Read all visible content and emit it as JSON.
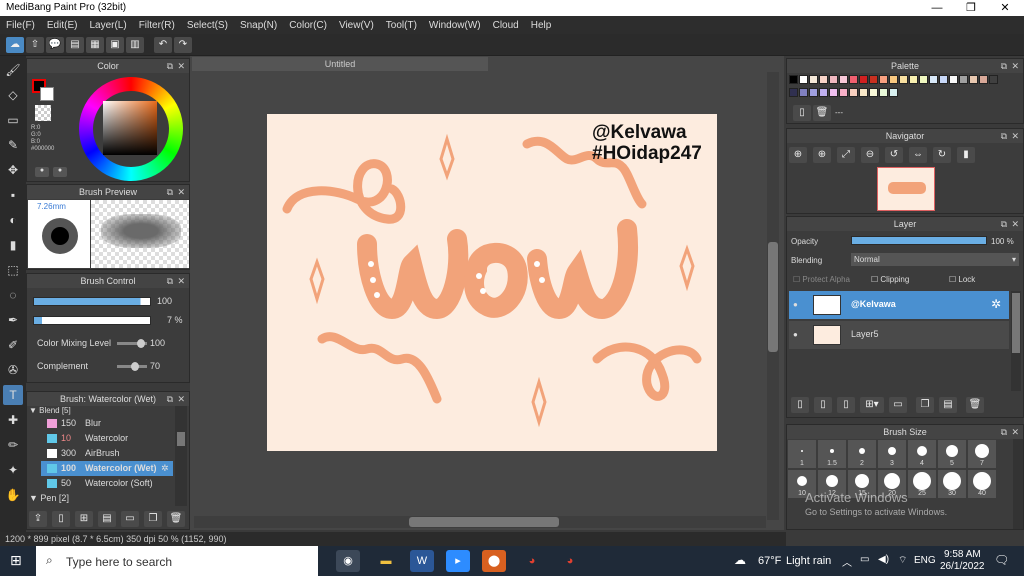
{
  "window": {
    "title": "MediBang Paint Pro (32bit)",
    "minimize": "—",
    "maximize": "❐",
    "close": "✕"
  },
  "menu": [
    "File(F)",
    "Edit(E)",
    "Layer(L)",
    "Filter(R)",
    "Select(S)",
    "Snap(N)",
    "Color(C)",
    "View(V)",
    "Tool(T)",
    "Window(W)",
    "Cloud",
    "Help"
  ],
  "toolbar": [
    "☁",
    "⇧",
    "💬",
    "▤",
    "▦",
    "▣",
    "▥",
    "↶",
    "↷"
  ],
  "tools": [
    "🖌",
    "◇",
    "▭",
    "✎",
    "✥",
    "▪",
    "◐",
    "▮",
    "⬚",
    "◌",
    "✒",
    "✐",
    "✇",
    "T",
    "✚",
    "✏",
    "✦",
    "✋"
  ],
  "color_panel": {
    "title": "Color",
    "rgb": [
      "R:0",
      "G:0",
      "B:0",
      "#000000"
    ]
  },
  "brush_preview": {
    "title": "Brush Preview",
    "size": "7.26mm"
  },
  "brush_control": {
    "title": "Brush Control",
    "size_value": "100",
    "opacity_value": "7 %",
    "mixing_label": "Color Mixing Level",
    "mixing_value": "100",
    "complement_label": "Complement",
    "complement_value": "70"
  },
  "brush_list": {
    "title": "Brush: Watercolor (Wet)",
    "group": "Blend [5]",
    "items": [
      {
        "size": "150",
        "name": "Blur",
        "color": "#f0a0d8"
      },
      {
        "size": "10",
        "name": "Watercolor",
        "color": "#60c8e8"
      },
      {
        "size": "300",
        "name": "AirBrush",
        "color": "#ffffff"
      },
      {
        "size": "100",
        "name": "Watercolor (Wet)",
        "color": "#60c8e8"
      },
      {
        "size": "50",
        "name": "Watercolor (Soft)",
        "color": "#60c8e8"
      }
    ],
    "pen_group": "Pen [2]"
  },
  "document": {
    "tab": "Untitled",
    "text1": "@Kelvawa",
    "text2": "#HOidap247"
  },
  "status": "1200 * 899 pixel  (8.7 * 6.5cm)  350 dpi  50 %  (1152, 990)",
  "palette": {
    "title": "Palette",
    "colors": [
      "#000000",
      "#ffffff",
      "#f4e8d8",
      "#f8d4c8",
      "#f0b8c0",
      "#f8c8d8",
      "#f06070",
      "#d02020",
      "#c83020",
      "#f8a080",
      "#f8c880",
      "#f8e0a0",
      "#f8f0b0",
      "#f0f8c0",
      "#d8e8f8",
      "#c8d8f8",
      "#f8f8f8",
      "#a0a0a0",
      "#e8c8b0",
      "#d8a898",
      "#404040",
      "#303050",
      "#8080c0",
      "#a0a0e0",
      "#c0b0f0",
      "#f0c0f0",
      "#f8b0c8",
      "#f8d0c0",
      "#f8e8c8",
      "#f8f8d8",
      "#e8f8d8",
      "#d8f0f0"
    ],
    "label": "---"
  },
  "navigator": {
    "title": "Navigator"
  },
  "layer": {
    "title": "Layer",
    "opacity_label": "Opacity",
    "opacity_value": "100 %",
    "blending_label": "Blending",
    "blending_value": "Normal",
    "protect_alpha": "Protect Alpha",
    "clipping": "Clipping",
    "lock": "Lock",
    "layers": [
      {
        "name": "@Kelvawa",
        "selected": true
      },
      {
        "name": "Layer5",
        "selected": false
      }
    ]
  },
  "brush_size": {
    "title": "Brush Size",
    "row1": [
      "1",
      "1.5",
      "2",
      "3",
      "4",
      "5",
      "7"
    ],
    "row2": [
      "10",
      "12",
      "15",
      "20",
      "25",
      "30",
      "40"
    ]
  },
  "watermark": {
    "line1": "Activate Windows",
    "line2": "Go to Settings to activate Windows."
  },
  "taskbar": {
    "search": "Type here to search",
    "weather_temp": "67°F",
    "weather_text": "Light rain",
    "lang": "ENG",
    "time": "9:58 AM",
    "date": "26/1/2022"
  },
  "colors": {
    "accent": "#4a90d0",
    "canvas": "#fdecdf",
    "lettering": "#f2a37a"
  }
}
